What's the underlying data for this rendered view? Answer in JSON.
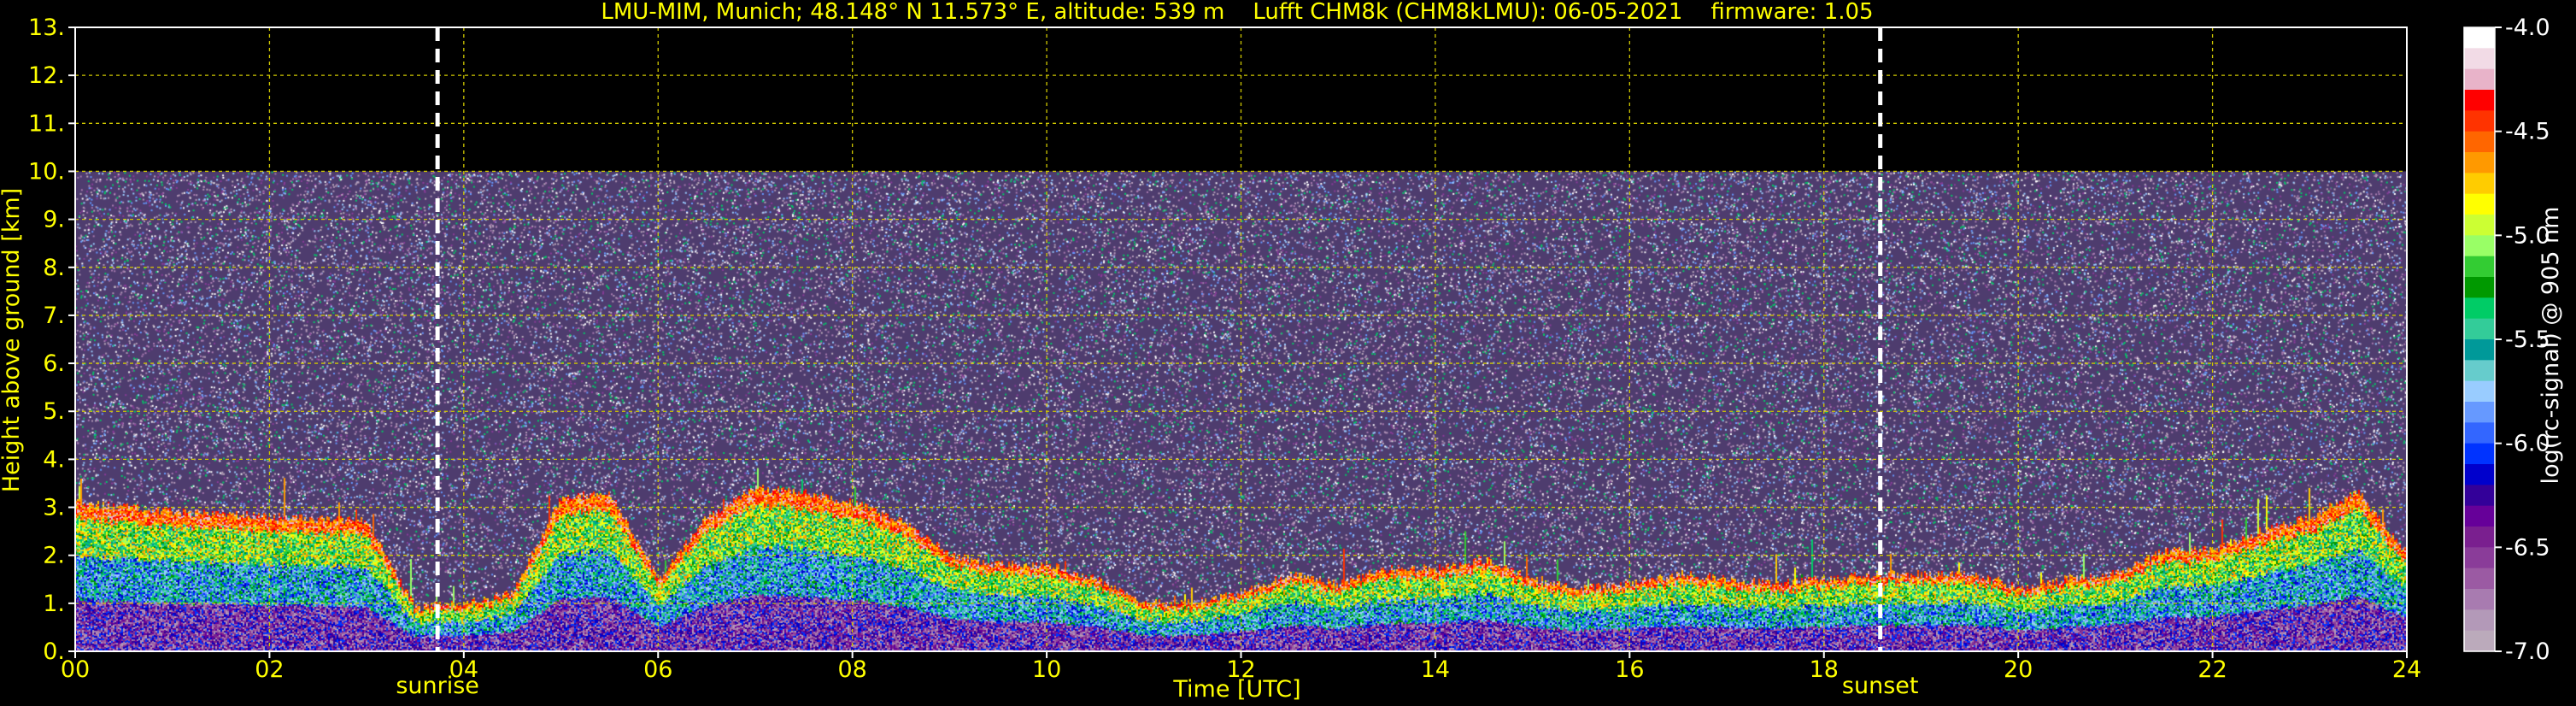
{
  "chart_data": {
    "type": "heatmap",
    "title": "LMU-MIM, Munich; 48.148° N 11.573° E, altitude: 539 m    Lufft CHM8k (CHM8kLMU): 06-05-2021    firmware: 1.05",
    "xlabel": "Time [UTC]",
    "ylabel": "Height above ground [km]",
    "xlim": [
      0,
      24
    ],
    "ylim": [
      0,
      13
    ],
    "x_ticks": [
      0,
      2,
      4,
      6,
      8,
      10,
      12,
      14,
      16,
      18,
      20,
      22,
      24
    ],
    "x_tick_labels": [
      "00",
      "02",
      "04",
      "06",
      "08",
      "10",
      "12",
      "14",
      "16",
      "18",
      "20",
      "22",
      "24"
    ],
    "y_ticks": [
      0,
      1,
      2,
      3,
      4,
      5,
      6,
      7,
      8,
      9,
      10,
      11,
      12,
      13
    ],
    "y_tick_labels": [
      "0.",
      "1.",
      "2.",
      "3.",
      "4.",
      "5.",
      "6.",
      "7.",
      "8.",
      "9.",
      "10.",
      "11.",
      "12.",
      "13."
    ],
    "grid": true,
    "measurement_top_km": 10,
    "events": [
      {
        "label": "sunrise",
        "time_utc": 3.73
      },
      {
        "label": "sunset",
        "time_utc": 18.58
      }
    ],
    "layer_tops_km": {
      "times_utc": [
        0,
        1,
        2,
        3,
        3.5,
        4,
        4.5,
        5,
        5.5,
        6,
        6.5,
        7,
        7.5,
        8,
        8.5,
        9,
        9.5,
        10,
        10.5,
        11,
        11.5,
        12,
        12.5,
        13,
        13.5,
        14,
        14.5,
        15,
        15.5,
        16,
        16.5,
        17,
        17.5,
        18,
        18.5,
        19,
        19.5,
        20,
        20.5,
        21,
        21.5,
        22,
        22.5,
        23,
        23.5,
        24
      ],
      "values": [
        3.1,
        2.9,
        2.8,
        2.7,
        0.9,
        1.0,
        1.2,
        3.2,
        3.3,
        1.5,
        2.8,
        3.4,
        3.3,
        3.1,
        2.7,
        2.0,
        1.8,
        1.8,
        1.5,
        1.0,
        1.0,
        1.2,
        1.6,
        1.4,
        1.7,
        1.7,
        1.9,
        1.5,
        1.3,
        1.4,
        1.6,
        1.5,
        1.4,
        1.5,
        1.6,
        1.6,
        1.6,
        1.3,
        1.5,
        1.6,
        2.1,
        2.1,
        2.5,
        2.8,
        3.3,
        2.0
      ]
    },
    "colorbar": {
      "label": "log(rc-signal) @ 905 nm",
      "min": -7.0,
      "max": -4.0,
      "ticks": [
        -4.0,
        -4.5,
        -5.0,
        -5.5,
        -6.0,
        -6.5,
        -7.0
      ],
      "tick_labels": [
        "-4.0",
        "-4.5",
        "-5.0",
        "-5.5",
        "-6.0",
        "-6.5",
        "-7.0"
      ],
      "colors": [
        "#ffffff",
        "#f2dbe6",
        "#e8b3c9",
        "#ff0000",
        "#ff3300",
        "#ff6600",
        "#ff9900",
        "#ffcc00",
        "#ffff00",
        "#ccff33",
        "#99ff66",
        "#33cc33",
        "#009900",
        "#00cc66",
        "#33cc99",
        "#009999",
        "#66cccc",
        "#99ccff",
        "#6699ff",
        "#3366ff",
        "#0033ff",
        "#0000cc",
        "#330099",
        "#660099",
        "#7a1f8f",
        "#8a3c99",
        "#9b5aa3",
        "#a87bb0",
        "#b399b8",
        "#bbaabb"
      ]
    }
  },
  "colors": {
    "background": "#000000",
    "label_color": "#ffff00",
    "text_color": "#ffffff",
    "grid_color": "#d0c800",
    "noise_base": "#4e3c6e",
    "event_line": "#ffffff"
  }
}
